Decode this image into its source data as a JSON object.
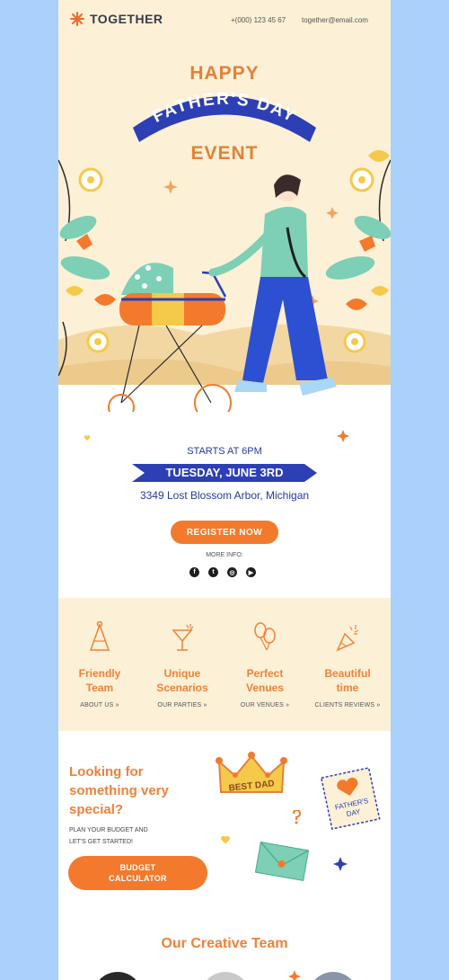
{
  "brand": {
    "name": "TOGETHER",
    "phone": "+(000) 123 45 67",
    "email": "together@email.com"
  },
  "hero": {
    "line1": "HAPPY",
    "banner": "FATHER'S DAY",
    "line3": "EVENT"
  },
  "event": {
    "starts": "STARTS AT 6PM",
    "date": "TUESDAY, JUNE 3RD",
    "address": "3349 Lost Blossom Arbor, Michigan",
    "register_label": "REGISTER NOW",
    "more_info": "MORE INFO:",
    "socials": [
      {
        "icon": "facebook-icon",
        "glyph": "f"
      },
      {
        "icon": "twitter-icon",
        "glyph": "t"
      },
      {
        "icon": "instagram-icon",
        "glyph": "◎"
      },
      {
        "icon": "youtube-icon",
        "glyph": "▶"
      }
    ]
  },
  "features": [
    {
      "title_1": "Friendly",
      "title_2": "Team",
      "link": "ABOUT US »",
      "icon": "party-hat-icon"
    },
    {
      "title_1": "Unique",
      "title_2": "Scenarios",
      "link": "OUR PARTIES »",
      "icon": "cocktail-icon"
    },
    {
      "title_1": "Perfect",
      "title_2": "Venues",
      "link": "OUR VENUES »",
      "icon": "balloons-icon"
    },
    {
      "title_1": "Beautiful",
      "title_2": "time",
      "link": "CLIENTS REVIEWS »",
      "icon": "party-popper-icon"
    }
  ],
  "special": {
    "title_1": "Looking for",
    "title_2": "something very",
    "title_3": "special?",
    "sub_1": "PLAN YOUR BUDGET AND",
    "sub_2": "LET'S GET STARTED!",
    "button_1": "BUDGET",
    "button_2": "CALCULATOR",
    "crown_text": "BEST DAD",
    "stamp_text_1": "FATHER'S",
    "stamp_text_2": "DAY"
  },
  "team": {
    "title": "Our Creative Team"
  },
  "colors": {
    "accent": "#f37a2c",
    "navy": "#263a9e",
    "cream": "#fcf1d6",
    "page_bg": "#a9d1fb"
  }
}
